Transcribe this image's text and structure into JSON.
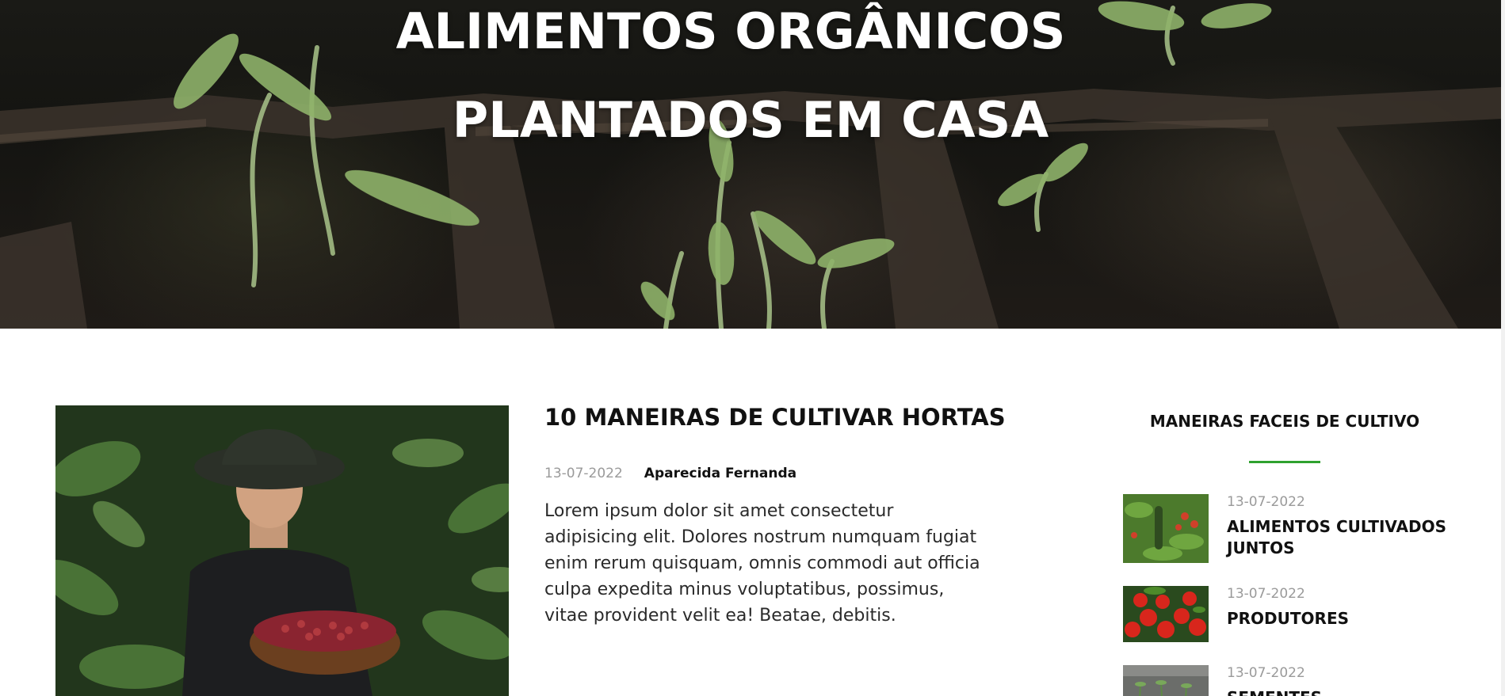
{
  "hero": {
    "title_line1": "ALIMENTOS ORGÂNICOS",
    "title_line2": "PLANTADOS EM CASA"
  },
  "article": {
    "title": "10 MANEIRAS DE CULTIVAR HORTAS",
    "date": "13-07-2022",
    "author": "Aparecida Fernanda",
    "excerpt": "Lorem ipsum dolor sit amet consectetur adipisicing elit. Dolores nostrum numquam fugiat enim rerum quisquam, omnis commodi aut officia culpa expedita minus voluptatibus, possimus, vitae provident velit ea! Beatae, debitis."
  },
  "sidebar": {
    "title": "MANEIRAS FACEIS DE CULTIVO",
    "accent_color": "#2fa12f",
    "posts": [
      {
        "date": "13-07-2022",
        "title": "ALIMENTOS CULTIVADOS JUNTOS"
      },
      {
        "date": "13-07-2022",
        "title": "PRODUTORES"
      },
      {
        "date": "13-07-2022",
        "title": "SEMENTES"
      }
    ]
  }
}
